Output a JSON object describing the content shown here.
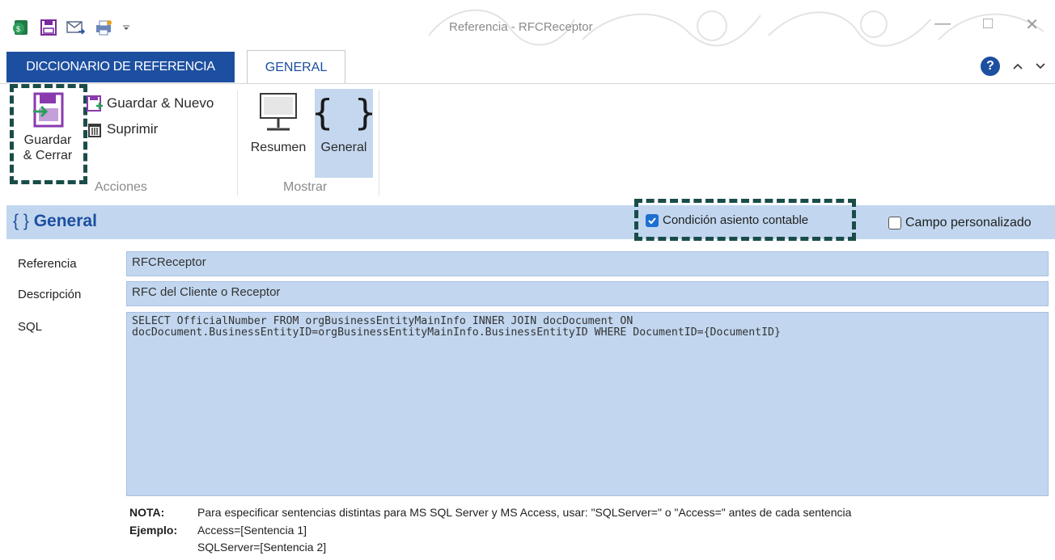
{
  "window": {
    "title": "Referencia - RFCReceptor"
  },
  "tabs": {
    "dictionary": "DICCIONARIO DE REFERENCIA",
    "general": "GENERAL"
  },
  "ribbon": {
    "save_close_line1": "Guardar",
    "save_close_line2": "& Cerrar",
    "save_new": "Guardar & Nuevo",
    "delete": "Suprimir",
    "group_actions": "Acciones",
    "summary": "Resumen",
    "general": "General",
    "group_show": "Mostrar"
  },
  "section": {
    "title": "General",
    "title_icon": "{ }",
    "accounting_condition": "Condición asiento contable",
    "accounting_condition_checked": true,
    "custom_field": "Campo personalizado",
    "custom_field_checked": false
  },
  "form": {
    "reference_label": "Referencia",
    "reference_value": "RFCReceptor",
    "description_label": "Descripción",
    "description_value": "RFC del Cliente o Receptor",
    "sql_label": "SQL",
    "sql_value": "SELECT OfficialNumber FROM orgBusinessEntityMainInfo INNER JOIN docDocument ON\ndocDocument.BusinessEntityID=orgBusinessEntityMainInfo.BusinessEntityID WHERE DocumentID={DocumentID}"
  },
  "note": {
    "nota_label": "NOTA:",
    "nota_text": "Para especificar sentencias distintas para MS SQL Server y MS Access, usar: \"SQLServer=\" o \"Access=\" antes de cada sentencia",
    "ejemplo_label": "Ejemplo:",
    "ejemplo_line1": "Access=[Sentencia 1]",
    "ejemplo_line2": "SQLServer=[Sentencia 2]"
  },
  "colors": {
    "accent_blue": "#1d4fa0",
    "field_bg": "#c2d7ef",
    "highlight_dash": "#1a4d4a"
  }
}
